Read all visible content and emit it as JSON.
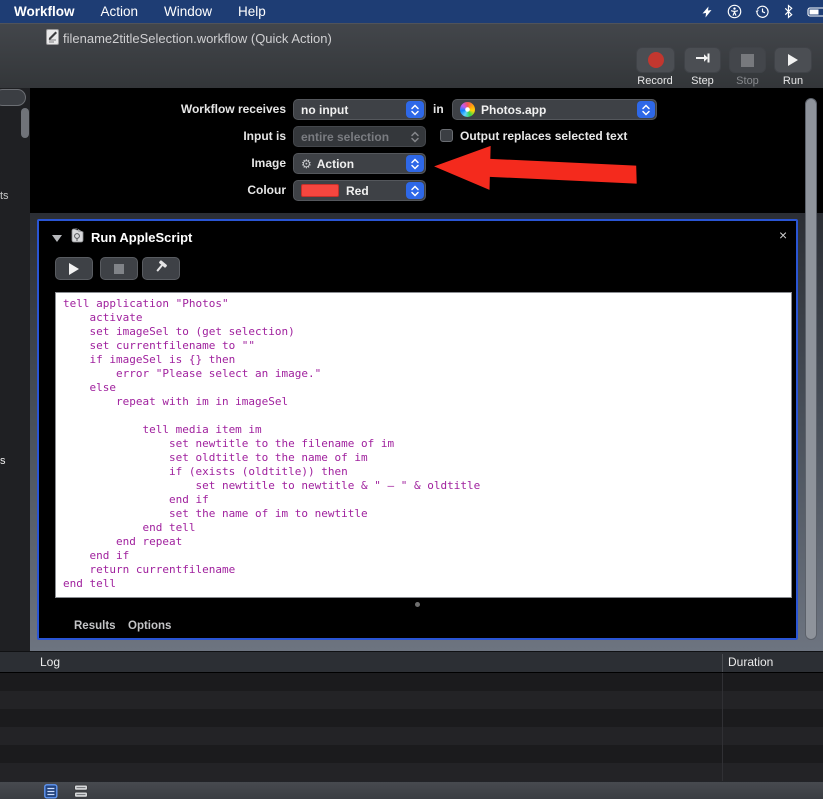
{
  "menu_bar": {
    "items": [
      "Workflow",
      "Action",
      "Window",
      "Help"
    ]
  },
  "title_bar": {
    "title": "filename2titleSelection.workflow (Quick Action)"
  },
  "toolbar": {
    "record_label": "Record",
    "step_label": "Step",
    "stop_label": "Stop",
    "run_label": "Run"
  },
  "sidebar_fragments": {
    "text_fragment_1": "ts",
    "text_fragment_2": "s"
  },
  "config": {
    "workflow_receives": {
      "label": "Workflow receives",
      "value": "no input",
      "in_label": "in",
      "app_value": "Photos.app"
    },
    "input_is": {
      "label": "Input is",
      "value": "entire selection"
    },
    "output_checkbox": {
      "label": "Output replaces selected text",
      "checked": false
    },
    "image": {
      "label": "Image",
      "value": "Action"
    },
    "colour": {
      "label": "Colour",
      "value": "Red"
    }
  },
  "action": {
    "title": "Run AppleScript",
    "close_label": "×",
    "code_lines": [
      "tell application \"Photos\"",
      "    activate",
      "    set imageSel to (get selection)",
      "    set currentfilename to \"\"",
      "    if imageSel is {} then",
      "        error \"Please select an image.\"",
      "    else",
      "        repeat with im in imageSel",
      "",
      "            tell media item im",
      "                set newtitle to the filename of im",
      "                set oldtitle to the name of im",
      "                if (exists (oldtitle)) then",
      "                    set newtitle to newtitle & \" – \" & oldtitle",
      "                end if",
      "                set the name of im to newtitle",
      "            end tell",
      "        end repeat",
      "    end if",
      "    return currentfilename",
      "end tell"
    ],
    "footer_tabs": {
      "results": "Results",
      "options": "Options"
    }
  },
  "log_pane": {
    "log_column": "Log",
    "duration_column": "Duration",
    "empty_row_count": 6
  },
  "colors": {
    "menu_bar_blue": "#1e3d74",
    "selection_border_blue": "#2a55d4",
    "stepper_blue": "#2e68e8",
    "code_magenta": "#a0219e",
    "arrow_red": "#f42a1d",
    "record_red": "#c2372f",
    "colour_swatch_red": "#f5463f"
  }
}
